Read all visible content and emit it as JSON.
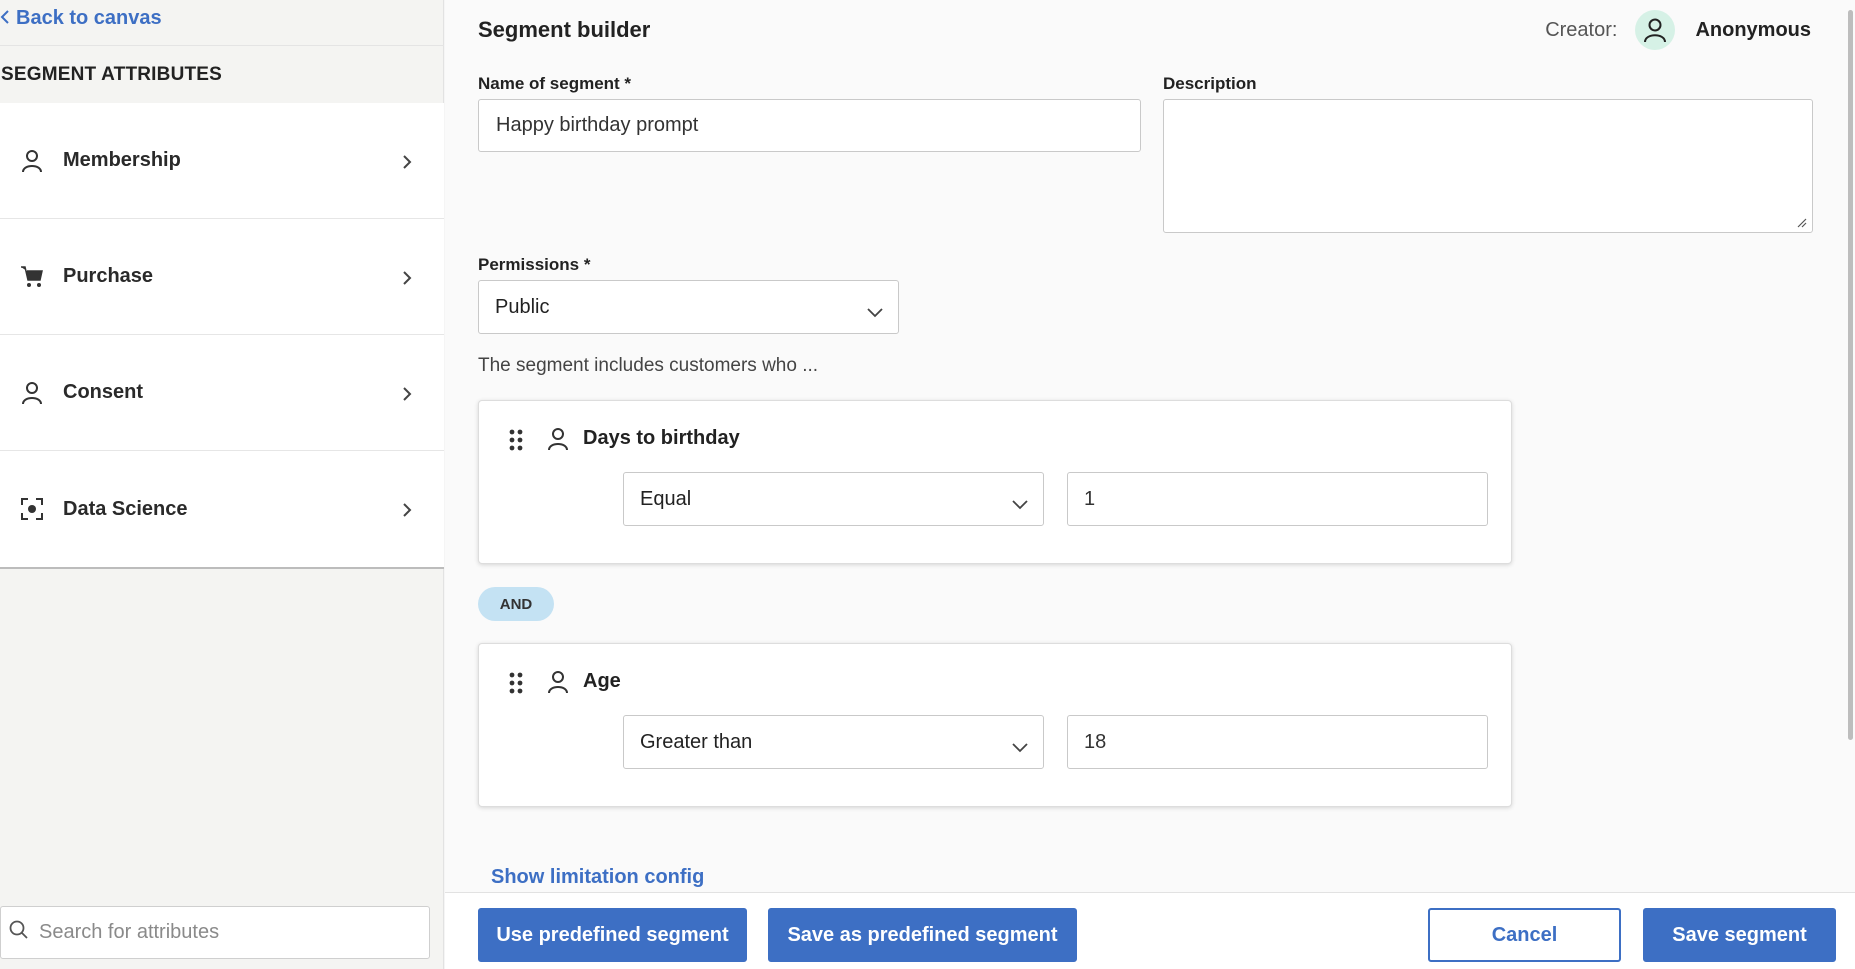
{
  "sidebar": {
    "back_label": "Back to canvas",
    "header": "SEGMENT ATTRIBUTES",
    "items": [
      {
        "label": "Membership",
        "icon": "person-icon"
      },
      {
        "label": "Purchase",
        "icon": "cart-icon"
      },
      {
        "label": "Consent",
        "icon": "person-icon"
      },
      {
        "label": "Data Science",
        "icon": "focus-icon"
      }
    ],
    "search_placeholder": "Search for attributes"
  },
  "header": {
    "title": "Segment builder",
    "creator_label": "Creator:",
    "creator_name": "Anonymous"
  },
  "form": {
    "name_label": "Name of segment *",
    "name_value": "Happy birthday prompt",
    "description_label": "Description",
    "description_value": "",
    "permissions_label": "Permissions *",
    "permissions_value": "Public",
    "intro_text": "The segment includes customers who ..."
  },
  "rules": [
    {
      "name": "Days to birthday",
      "operator": "Equal",
      "value": "1"
    },
    {
      "name": "Age",
      "operator": "Greater than",
      "value": "18"
    }
  ],
  "connector": "AND",
  "limit_link": "Show limitation config",
  "footer": {
    "use_predefined": "Use predefined segment",
    "save_predefined": "Save as predefined segment",
    "cancel": "Cancel",
    "save": "Save segment"
  },
  "colors": {
    "accent": "#3d6fc4",
    "and_badge": "#c4e2f3",
    "avatar_bg": "#d6f1e6"
  }
}
